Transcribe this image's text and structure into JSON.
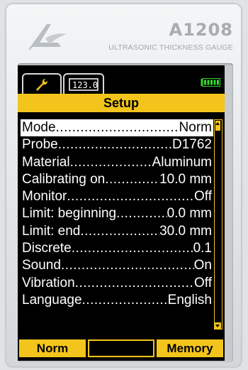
{
  "device": {
    "model": "A1208",
    "subtitle": "ULTRASONIC THICKNESS GAUGE"
  },
  "tabs": [
    {
      "name": "settings",
      "icon": "wrench-icon",
      "active": true
    },
    {
      "name": "measure",
      "icon": "measurement-display-icon",
      "text": "123.0",
      "active": false
    }
  ],
  "battery": {
    "icon": "battery-icon",
    "level": 1.0
  },
  "screen": {
    "title": "Setup",
    "menu": [
      {
        "label": "Mode",
        "value": "Norm",
        "selected": true
      },
      {
        "label": "Probe ",
        "value": "D1762"
      },
      {
        "label": "Material",
        "value": "Aluminum"
      },
      {
        "label": "Calibrating on",
        "value": "10.0 mm"
      },
      {
        "label": "Monitor",
        "value": "Off"
      },
      {
        "label": "Limit: beginning",
        "value": "0.0 mm"
      },
      {
        "label": "Limit: end ",
        "value": "30.0 mm"
      },
      {
        "label": "Discrete",
        "value": "0.1"
      },
      {
        "label": "Sound",
        "value": "On"
      },
      {
        "label": "Vibration ",
        "value": "Off"
      },
      {
        "label": "Language ",
        "value": "English"
      }
    ]
  },
  "softkeys": {
    "left": "Norm",
    "middle": "",
    "right": "Memory"
  },
  "colors": {
    "accent": "#f3c51c",
    "screen_bg": "#000000",
    "text": "#ffffff",
    "battery": "#39d62f"
  }
}
